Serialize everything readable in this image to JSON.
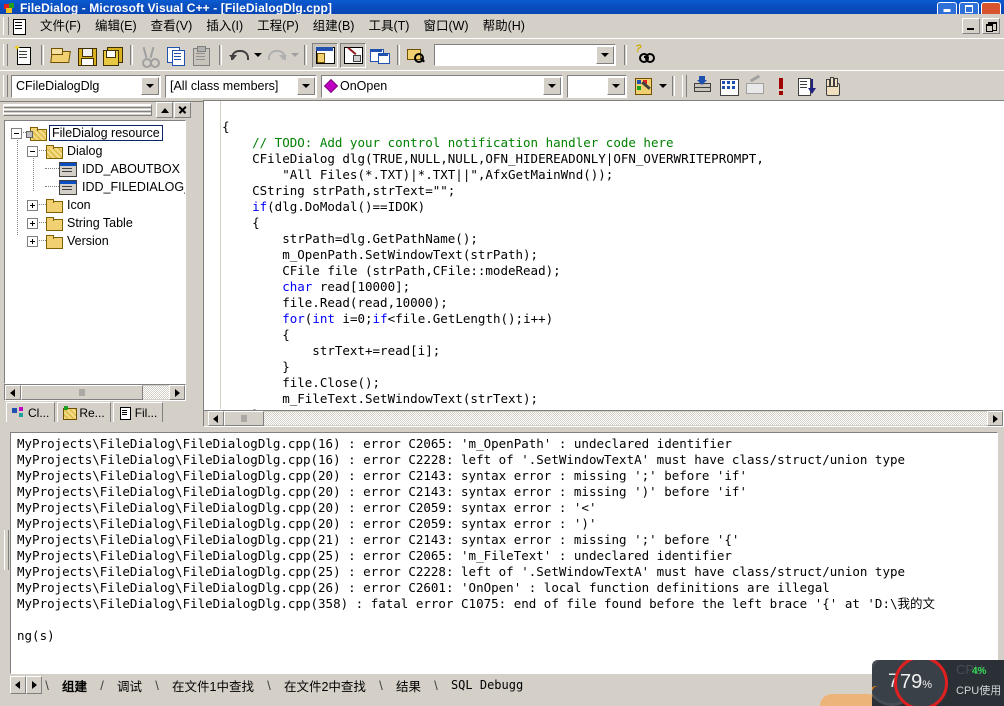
{
  "window": {
    "title": "FileDialog - Microsoft Visual C++ - [FileDialogDlg.cpp]",
    "app_icon": "vc-app-icon",
    "buttons": {
      "minimize": "minimize-icon",
      "restore": "restore-icon",
      "close": "close-icon"
    },
    "mdi_buttons": {
      "minimize": "mdi-minimize-icon",
      "restore": "mdi-restore-icon"
    }
  },
  "menubar": {
    "doc_icon": "document-icon",
    "items": [
      "文件(F)",
      "编辑(E)",
      "查看(V)",
      "插入(I)",
      "工程(P)",
      "组建(B)",
      "工具(T)",
      "窗口(W)",
      "帮助(H)"
    ]
  },
  "toolbar_standard": {
    "buttons": [
      "new-file-icon",
      "open-file-icon",
      "save-icon",
      "save-all-icon",
      "cut-icon",
      "copy-icon",
      "paste-icon",
      "undo-icon",
      "undo-dropdown-icon",
      "redo-icon",
      "redo-dropdown-icon",
      "workspace-toggle-icon",
      "output-toggle-icon",
      "window-list-icon",
      "find-in-files-icon"
    ],
    "find_box_value": "",
    "find_box_placeholder": "",
    "help_button": "find-help-icon"
  },
  "wizardbar": {
    "class_combo": {
      "value": "CFileDialogDlg"
    },
    "members_combo": {
      "value": "[All class members]"
    },
    "function_combo": {
      "value": "OnOpen",
      "icon": "protected-method-icon"
    },
    "actions_combo": {
      "value": "",
      "icon": "wizardbar-actions-icon"
    },
    "buttons": [
      "compile-icon",
      "build-icon",
      "stop-build-icon",
      "execute-icon",
      "go-debug-icon",
      "insert-breakpoint-icon"
    ]
  },
  "workspace": {
    "panel_buttons": {
      "dock": "dock-icon",
      "close": "close-icon"
    },
    "tree": [
      {
        "label": "FileDialog resource",
        "icon": "resource-folder-icon",
        "expander": "minus",
        "depth": 0,
        "selected": true
      },
      {
        "label": "Dialog",
        "icon": "folder-open-icon",
        "expander": "minus",
        "depth": 1,
        "selected": false
      },
      {
        "label": "IDD_ABOUTBOX",
        "icon": "dialog-icon",
        "expander": "none",
        "depth": 2,
        "selected": false
      },
      {
        "label": "IDD_FILEDIALOG_DIALOG",
        "icon": "dialog-icon",
        "expander": "none",
        "depth": 2,
        "selected": false
      },
      {
        "label": "Icon",
        "icon": "folder-icon",
        "expander": "plus",
        "depth": 1,
        "selected": false
      },
      {
        "label": "String Table",
        "icon": "folder-icon",
        "expander": "plus",
        "depth": 1,
        "selected": false
      },
      {
        "label": "Version",
        "icon": "folder-icon",
        "expander": "plus",
        "depth": 1,
        "selected": false
      }
    ],
    "tabs": [
      {
        "label": "Cl...",
        "icon": "classview-icon"
      },
      {
        "label": "Re...",
        "icon": "resourceview-icon"
      },
      {
        "label": "Fil...",
        "icon": "fileview-icon"
      }
    ]
  },
  "editor": {
    "filename": "FileDialogDlg.cpp",
    "lines": [
      {
        "text": "{",
        "type": "plain"
      },
      {
        "text": "    // TODO: Add your control notification handler code here",
        "type": "comment"
      },
      {
        "text": "    CFileDialog dlg(TRUE,NULL,NULL,OFN_HIDEREADONLY|OFN_OVERWRITEPROMPT,",
        "type": "plain"
      },
      {
        "text": "        \"All Files(*.TXT)|*.TXT||\",AfxGetMainWnd());",
        "type": "plain"
      },
      {
        "text": "    CString strPath,strText=\"\";",
        "type": "plain"
      },
      {
        "text": "    if(dlg.DoModal()==IDOK)",
        "type": "keyword-if"
      },
      {
        "text": "    {",
        "type": "plain"
      },
      {
        "text": "        strPath=dlg.GetPathName();",
        "type": "plain"
      },
      {
        "text": "        m_OpenPath.SetWindowText(strPath);",
        "type": "plain"
      },
      {
        "text": "        CFile file (strPath,CFile::modeRead);",
        "type": "plain"
      },
      {
        "text": "        char read[10000];",
        "type": "keyword-char"
      },
      {
        "text": "        file.Read(read,10000);",
        "type": "plain"
      },
      {
        "text": "        for(int i=0;if<file.GetLength();i++)",
        "type": "keyword-for"
      },
      {
        "text": "        {",
        "type": "plain"
      },
      {
        "text": "            strText+=read[i];",
        "type": "plain"
      },
      {
        "text": "        }",
        "type": "plain"
      },
      {
        "text": "        file.Close();",
        "type": "plain"
      },
      {
        "text": "        m_FileText.SetWindowText(strText);",
        "type": "plain"
      },
      {
        "text": "    }",
        "type": "plain"
      }
    ]
  },
  "output": {
    "lines": [
      "MyProjects\\FileDialog\\FileDialogDlg.cpp(16) : error C2065: 'm_OpenPath' : undeclared identifier",
      "MyProjects\\FileDialog\\FileDialogDlg.cpp(16) : error C2228: left of '.SetWindowTextA' must have class/struct/union type",
      "MyProjects\\FileDialog\\FileDialogDlg.cpp(20) : error C2143: syntax error : missing ';' before 'if'",
      "MyProjects\\FileDialog\\FileDialogDlg.cpp(20) : error C2143: syntax error : missing ')' before 'if'",
      "MyProjects\\FileDialog\\FileDialogDlg.cpp(20) : error C2059: syntax error : '<'",
      "MyProjects\\FileDialog\\FileDialogDlg.cpp(20) : error C2059: syntax error : ')'",
      "MyProjects\\FileDialog\\FileDialogDlg.cpp(21) : error C2143: syntax error : missing ';' before '{'",
      "MyProjects\\FileDialog\\FileDialogDlg.cpp(25) : error C2065: 'm_FileText' : undeclared identifier",
      "MyProjects\\FileDialog\\FileDialogDlg.cpp(25) : error C2228: left of '.SetWindowTextA' must have class/struct/union type",
      "MyProjects\\FileDialog\\FileDialogDlg.cpp(26) : error C2601: 'OnOpen' : local function definitions are illegal",
      "MyProjects\\FileDialog\\FileDialogDlg.cpp(358) : fatal error C1075: end of file found before the left brace '{' at 'D:\\我的文",
      "",
      "ng(s)"
    ],
    "tabs": [
      {
        "label": "组建",
        "active": true
      },
      {
        "label": "调试",
        "active": false
      },
      {
        "label": "在文件1中查找",
        "active": false
      },
      {
        "label": "在文件2中查找",
        "active": false
      },
      {
        "label": "结果",
        "active": false
      },
      {
        "label": "SQL Debugg",
        "active": false
      }
    ],
    "nav": {
      "prev": "scroll-left-icon",
      "next": "scroll-right-icon",
      "more": "tab-scroll-right-icon"
    }
  },
  "gadget": {
    "left_value": "7",
    "main_value": "79",
    "main_unit": "%",
    "ghost_text": "CPU",
    "small_value": "4%",
    "caption": "CPU使用",
    "accent_color": "#e02020",
    "green_color": "#33dd55"
  }
}
